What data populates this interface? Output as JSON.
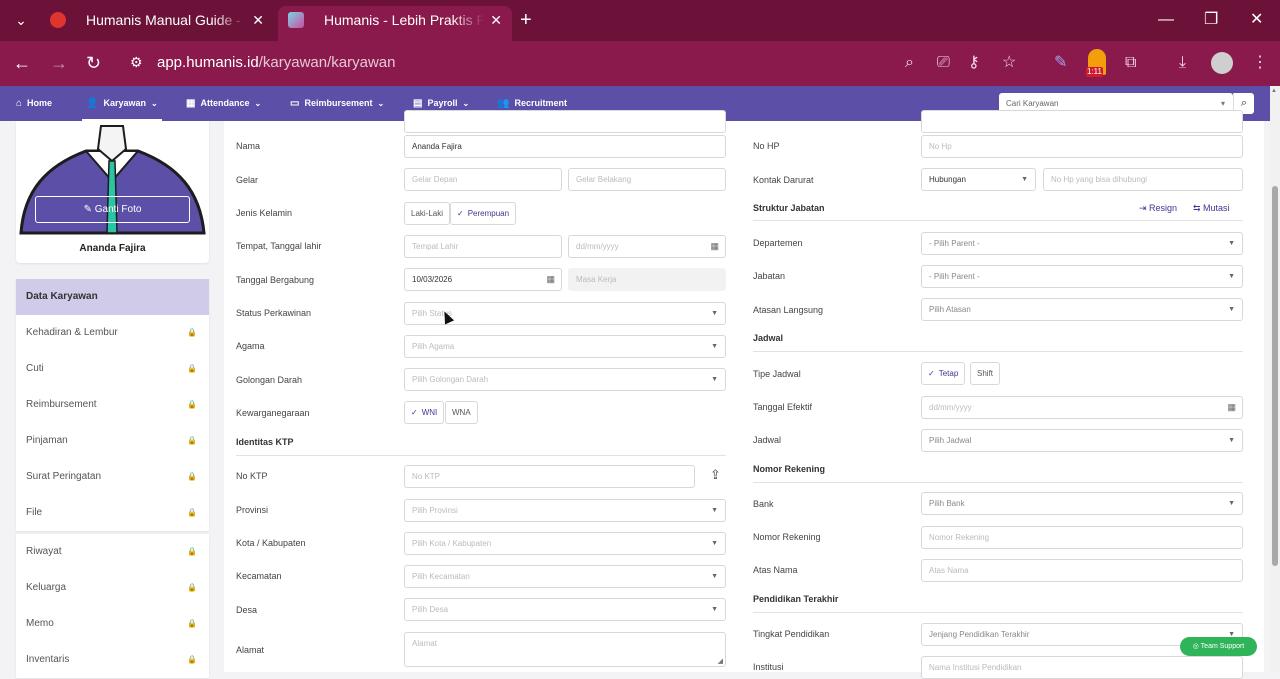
{
  "browser": {
    "tabs": [
      {
        "title": "Humanis Manual Guide - Xmind",
        "active": false
      },
      {
        "title": "Humanis - Lebih Praktis Pakai Humanis",
        "active": true
      }
    ],
    "url_host": "app.humanis.id",
    "url_path": "/karyawan/karyawan",
    "badge": "1:11",
    "colors": {
      "tabbar": "#6c1239",
      "toolbar": "#8b1a4c"
    }
  },
  "appnav": {
    "items": [
      {
        "label": "Home",
        "icon": "home-icon"
      },
      {
        "label": "Karyawan",
        "icon": "user-edit-icon"
      },
      {
        "label": "Attendance",
        "icon": "calendar-icon"
      },
      {
        "label": "Reimbursement",
        "icon": "money-icon"
      },
      {
        "label": "Payroll",
        "icon": "folder-icon"
      },
      {
        "label": "Recruitment",
        "icon": "users-icon"
      }
    ],
    "search_placeholder": "Cari Karyawan",
    "color": "#5b4fa8"
  },
  "profile": {
    "change_photo": "Ganti Foto",
    "name": "Ananda Fajira"
  },
  "sidebar": {
    "group1": [
      {
        "label": "Data Karyawan",
        "active": true,
        "locked": false
      },
      {
        "label": "Kehadiran & Lembur",
        "locked": true
      },
      {
        "label": "Cuti",
        "locked": true
      },
      {
        "label": "Reimbursement",
        "locked": true
      },
      {
        "label": "Pinjaman",
        "locked": true
      },
      {
        "label": "Surat Peringatan",
        "locked": true
      },
      {
        "label": "File",
        "locked": true
      }
    ],
    "group2": [
      {
        "label": "Riwayat",
        "locked": true
      },
      {
        "label": "Keluarga",
        "locked": true
      },
      {
        "label": "Memo",
        "locked": true
      },
      {
        "label": "Inventaris",
        "locked": true
      }
    ]
  },
  "left_form": {
    "nama": {
      "label": "Nama",
      "value": "Ananda Fajira"
    },
    "gelar": {
      "label": "Gelar",
      "depan": "Gelar Depan",
      "belakang": "Gelar Belakang"
    },
    "jenis_kelamin": {
      "label": "Jenis Kelamin",
      "opt1": "Laki-Laki",
      "opt2": "Perempuan",
      "selected": "Perempuan"
    },
    "ttl": {
      "label": "Tempat, Tanggal lahir",
      "tempat": "Tempat Lahir",
      "tanggal": "dd/mm/yyyy"
    },
    "bergabung": {
      "label": "Tanggal Bergabung",
      "value": "10/03/2026",
      "masa_kerja": "Masa Kerja"
    },
    "perkawinan": {
      "label": "Status Perkawinan",
      "placeholder": "Pilih Status"
    },
    "agama": {
      "label": "Agama",
      "placeholder": "Pilih Agama"
    },
    "darah": {
      "label": "Golongan Darah",
      "placeholder": "Pilih Golongan Darah"
    },
    "kewarganegaraan": {
      "label": "Kewarganegaraan",
      "opt1": "WNI",
      "opt2": "WNA",
      "selected": "WNI"
    },
    "ktp_section": "Identitas KTP",
    "no_ktp": {
      "label": "No KTP",
      "placeholder": "No KTP"
    },
    "provinsi": {
      "label": "Provinsi",
      "placeholder": "Pilih Provinsi"
    },
    "kota": {
      "label": "Kota / Kabupaten",
      "placeholder": "Pilih Kota / Kabupaten"
    },
    "kecamatan": {
      "label": "Kecamatan",
      "placeholder": "Pilih Kecamatan"
    },
    "desa": {
      "label": "Desa",
      "placeholder": "Pilih Desa"
    },
    "alamat": {
      "label": "Alamat",
      "placeholder": "Alamat"
    }
  },
  "right_form": {
    "no_hp": {
      "label": "No HP",
      "placeholder": "No Hp"
    },
    "kontak": {
      "label": "Kontak Darurat",
      "hubungan": "Hubungan",
      "placeholder": "No Hp yang bisa dihubungi"
    },
    "struktur_section": "Struktur Jabatan",
    "resign": "Resign",
    "mutasi": "Mutasi",
    "departemen": {
      "label": "Departemen",
      "placeholder": "- Pilih Parent -"
    },
    "jabatan": {
      "label": "Jabatan",
      "placeholder": "- Pilih Parent -"
    },
    "atasan": {
      "label": "Atasan Langsung",
      "placeholder": "Pilih Atasan"
    },
    "jadwal_section": "Jadwal",
    "tipe_jadwal": {
      "label": "Tipe Jadwal",
      "opt1": "Tetap",
      "opt2": "Shift",
      "selected": "Tetap"
    },
    "tgl_efektif": {
      "label": "Tanggal Efektif",
      "placeholder": "dd/mm/yyyy"
    },
    "jadwal": {
      "label": "Jadwal",
      "placeholder": "Pilih Jadwal"
    },
    "rekening_section": "Nomor Rekening",
    "bank": {
      "label": "Bank",
      "placeholder": "Pilih Bank"
    },
    "no_rek": {
      "label": "Nomor Rekening",
      "placeholder": "Nomor Rekening"
    },
    "atas_nama": {
      "label": "Atas Nama",
      "placeholder": "Atas Nama"
    },
    "pendidikan_section": "Pendidikan Terakhir",
    "tingkat": {
      "label": "Tingkat Pendidikan",
      "placeholder": "Jenjang Pendidikan Terakhir"
    },
    "institusi": {
      "label": "Institusi",
      "placeholder": "Nama Institusi Pendidikan"
    }
  },
  "support": "Team Support"
}
